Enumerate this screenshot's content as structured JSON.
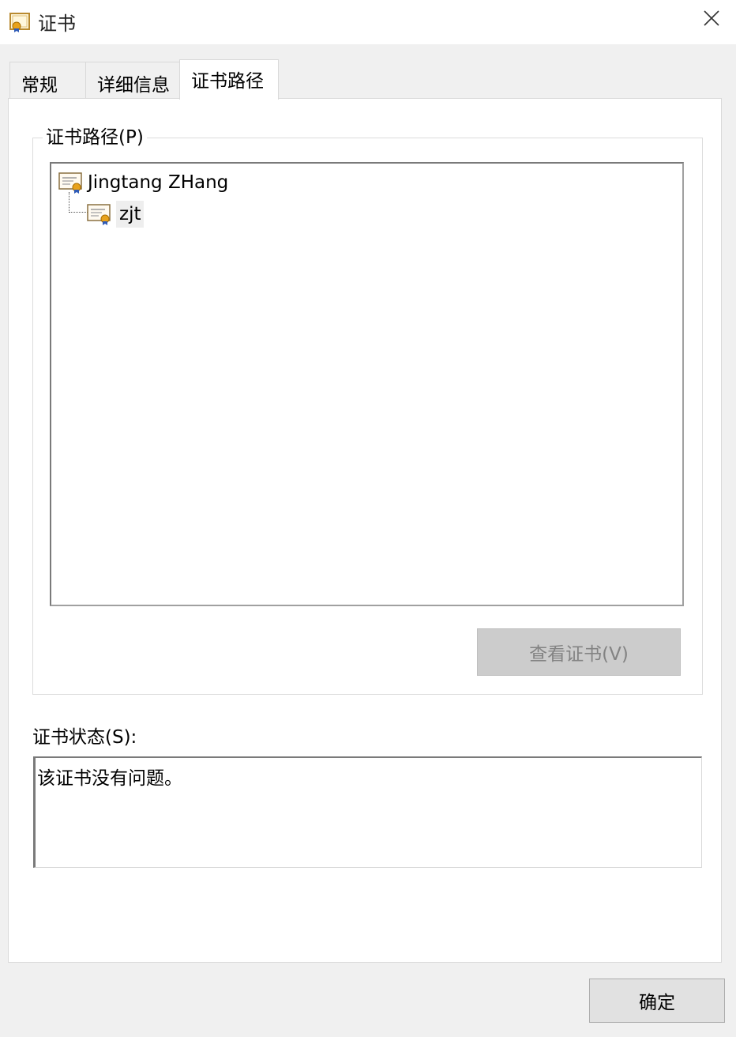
{
  "window": {
    "title": "证书",
    "close_icon": "close-icon"
  },
  "tabs": [
    {
      "label": "常规",
      "active": false
    },
    {
      "label": "详细信息",
      "active": false
    },
    {
      "label": "证书路径",
      "active": true
    }
  ],
  "cert_path": {
    "group_label": "证书路径(P)",
    "tree": [
      {
        "label": "Jingtang ZHang",
        "icon": "certificate-icon",
        "level": 0
      },
      {
        "label": "zjt",
        "icon": "certificate-icon",
        "level": 1,
        "selected": true
      }
    ],
    "view_button_label": "查看证书(V)",
    "view_button_enabled": false
  },
  "status": {
    "label": "证书状态(S):",
    "text": "该证书没有问题。"
  },
  "footer": {
    "ok_label": "确定"
  },
  "colors": {
    "accent_gold": "#e8a21c",
    "ribbon_blue": "#2f5bb7",
    "disabled_button": "#cccccc"
  }
}
